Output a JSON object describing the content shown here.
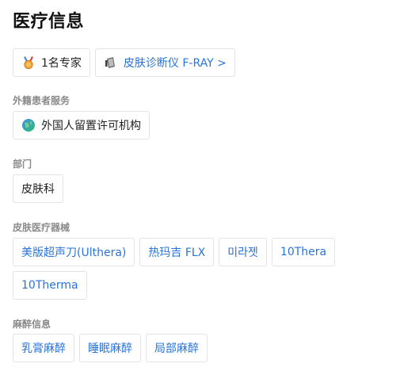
{
  "page": {
    "title": "医疗信息"
  },
  "top_chips": {
    "experts": "1名专家",
    "device": "皮肤诊断仪 F-RAY >"
  },
  "foreign_service": {
    "label": "外籍患者服务",
    "item": "外国人留置许可机构"
  },
  "department": {
    "label": "部门",
    "item": "皮肤科"
  },
  "equipment": {
    "label": "皮肤医疗器械",
    "items": [
      "美版超声刀(Ulthera)",
      "热玛吉 FLX",
      "미라젯",
      "10Thera",
      "10Therma"
    ]
  },
  "anesthesia": {
    "label": "麻醉信息",
    "items": [
      "乳膏麻醉",
      "睡眠麻醉",
      "局部麻醉"
    ]
  },
  "icons": {
    "medal": "medal-icon",
    "device": "device-icon",
    "globe": "globe-icon"
  },
  "colors": {
    "link": "#2a73d9",
    "border": "#e3e3e3",
    "label": "#8a8a8a"
  }
}
